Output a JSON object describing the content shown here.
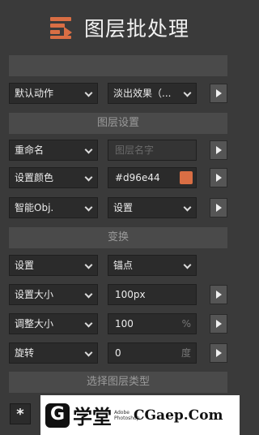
{
  "header": {
    "title": "图层批处理",
    "logo_icon": "layers-export-icon",
    "logo_color": "#d96e44"
  },
  "action_row": {
    "left": "默认动作",
    "right": "淡出效果（..."
  },
  "sections": {
    "layer_settings": "图层设置",
    "transform": "变换",
    "layer_type": "选择图层类型"
  },
  "rows": {
    "rename": {
      "label": "重命名",
      "placeholder": "图层名字"
    },
    "color": {
      "label": "设置颜色",
      "value": "#d96e44",
      "swatch": "#d96e44"
    },
    "smart": {
      "label": "智能Obj.",
      "value": "设置"
    },
    "set_anchor": {
      "label": "设置",
      "value": "锚点"
    },
    "size": {
      "label": "设置大小",
      "value": "100px"
    },
    "resize": {
      "label": "调整大小",
      "value": "100",
      "unit": "%"
    },
    "rotate": {
      "label": "旋转",
      "value": "0",
      "unit": "度"
    }
  },
  "bottom": {
    "asterisk": "*"
  },
  "watermark": {
    "glyph": "G",
    "cn": "学堂",
    "small": "Adobe Photoshop",
    "domain": "CGaep.Com"
  }
}
